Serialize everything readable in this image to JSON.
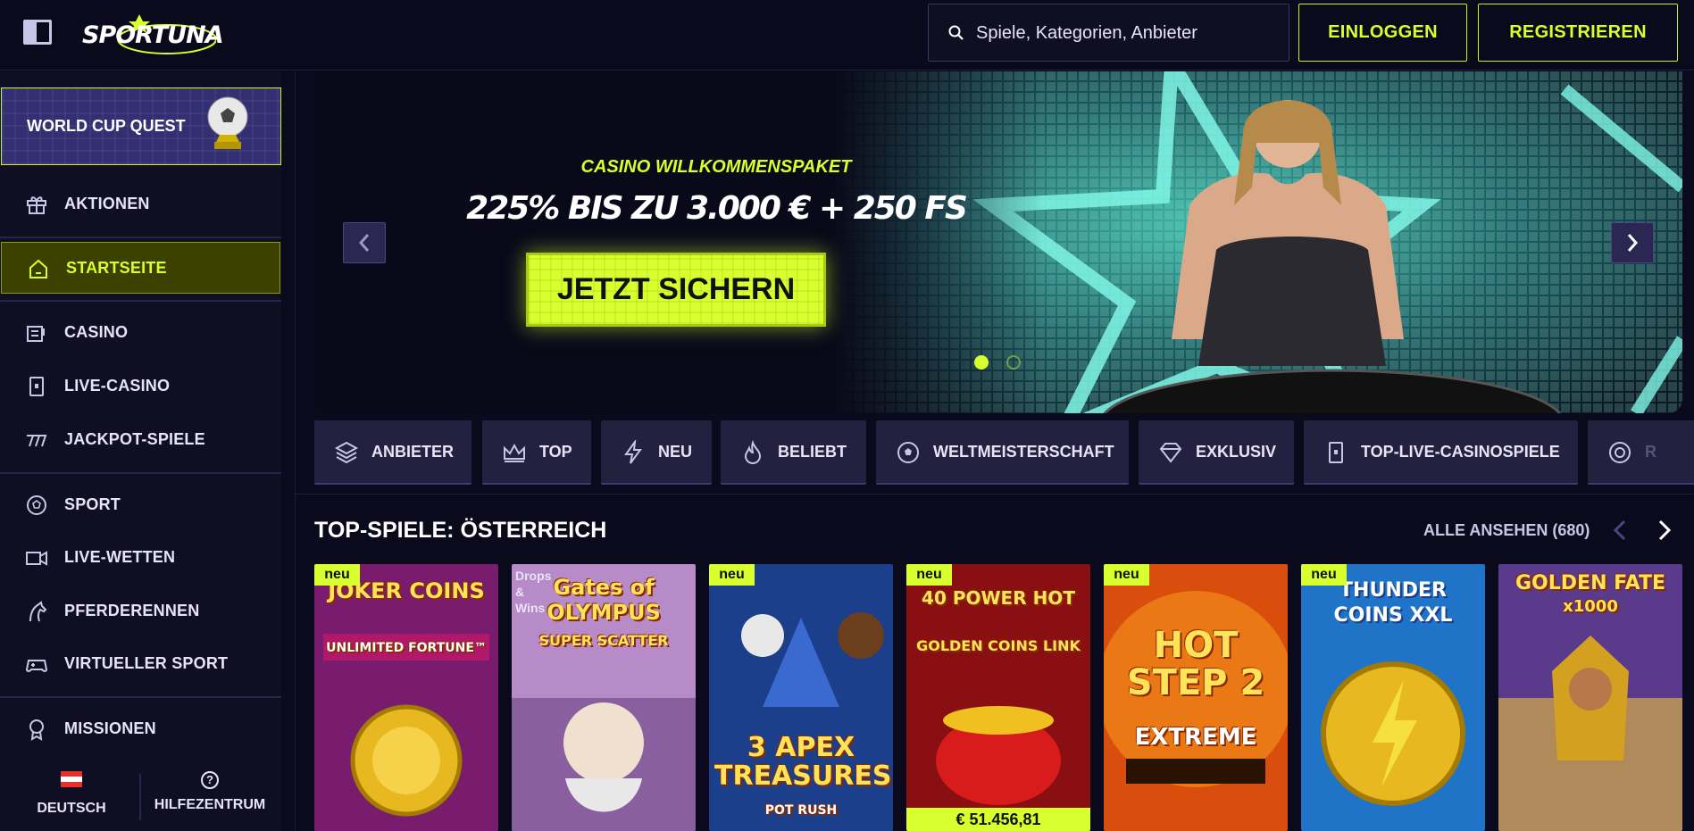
{
  "header": {
    "logo_text": "SPORTUNA",
    "search_placeholder": "Spiele, Kategorien, Anbieter",
    "login_label": "EINLOGGEN",
    "register_label": "REGISTRIEREN"
  },
  "sidebar": {
    "quest_label": "WORLD CUP QUEST",
    "items": [
      {
        "label": "AKTIONEN",
        "icon": "gift-icon"
      },
      {
        "label": "STARTSEITE",
        "icon": "home-icon",
        "active": true
      },
      {
        "label": "CASINO",
        "icon": "slot-machine-icon"
      },
      {
        "label": "LIVE-CASINO",
        "icon": "playing-card-icon"
      },
      {
        "label": "JACKPOT-SPIELE",
        "icon": "triple-seven-icon"
      },
      {
        "label": "SPORT",
        "icon": "soccer-ball-icon"
      },
      {
        "label": "LIVE-WETTEN",
        "icon": "video-camera-icon"
      },
      {
        "label": "PFERDERENNEN",
        "icon": "horse-icon"
      },
      {
        "label": "VIRTUELLER SPORT",
        "icon": "gamepad-icon"
      },
      {
        "label": "MISSIONEN",
        "icon": "medal-icon"
      }
    ],
    "footer": {
      "language_label": "DEUTSCH",
      "help_label": "HILFEZENTRUM"
    }
  },
  "hero": {
    "subtitle": "CASINO WILLKOMMENSPAKET",
    "title": "225% BIS ZU 3.000 € + 250 FS",
    "cta_label": "JETZT SICHERN",
    "active_slide": 1,
    "slide_count": 2
  },
  "filters": [
    {
      "label": "ANBIETER",
      "icon": "layers-icon"
    },
    {
      "label": "TOP",
      "icon": "crown-icon"
    },
    {
      "label": "NEU",
      "icon": "lightning-icon"
    },
    {
      "label": "BELIEBT",
      "icon": "flame-icon"
    },
    {
      "label": "WELTMEISTERSCHAFT",
      "icon": "soccer-ball-icon"
    },
    {
      "label": "EXKLUSIV",
      "icon": "diamond-icon"
    },
    {
      "label": "TOP-LIVE-CASINOSPIELE",
      "icon": "playing-card-icon"
    },
    {
      "label": "R",
      "icon": "roulette-icon"
    }
  ],
  "top_games": {
    "title": "TOP-SPIELE: ÖSTERREICH",
    "see_all_label": "ALLE ANSEHEN (680)",
    "games": [
      {
        "name": "JOKER COINS",
        "sub": "UNLIMITED FORTUNE™",
        "badge": "neu",
        "bg": "#7a1c6e"
      },
      {
        "name": "Gates of OLYMPUS",
        "sub": "SUPER SCATTER",
        "badge": "",
        "drops": "Drops & Wins",
        "bg": "#b78ac8"
      },
      {
        "name": "3 APEX TREASURES",
        "sub": "POT RUSH",
        "badge": "neu",
        "bg": "#1b3f8a"
      },
      {
        "name": "40 POWER HOT",
        "sub": "GOLDEN COINS LINK",
        "badge": "neu",
        "jackpot": "€ 51.456,81",
        "bg": "#8a0f12"
      },
      {
        "name": "HOT STEP 2",
        "sub": "EXTREME",
        "badge": "neu",
        "bg": "#d94e0c"
      },
      {
        "name": "THUNDER COINS XXL",
        "sub": "",
        "badge": "neu",
        "bg": "#1f74c8"
      },
      {
        "name": "GOLDEN FATE",
        "sub": "x1000",
        "badge": "",
        "bg": "#5a3a8a"
      }
    ]
  },
  "colors": {
    "accent": "#d8ff2e",
    "background": "#0b0a1c",
    "sidebar": "#0f0e22",
    "chip": "#23213f"
  }
}
